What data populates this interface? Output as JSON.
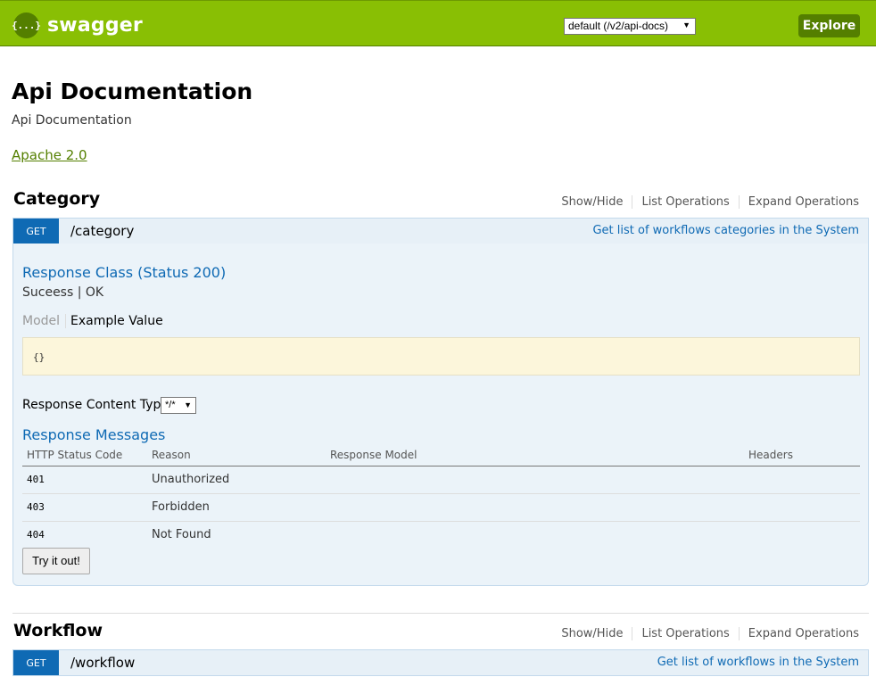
{
  "header": {
    "logo_symbol": "{...}",
    "logo_text": "swagger",
    "spec_select_value": "default (/v2/api-docs)",
    "explore_label": "Explore",
    "bg_color": "#89bf04"
  },
  "info": {
    "title": "Api Documentation",
    "description": "Api Documentation",
    "license": "Apache 2.0"
  },
  "resources": [
    {
      "name": "Category",
      "links": [
        "Show/Hide",
        "List Operations",
        "Expand Operations"
      ],
      "operation": {
        "method": "GET",
        "path": "/category",
        "summary": "Get list of workflows categories in the System",
        "response_class_heading": "Response Class (Status 200)",
        "response_class_text": "Suceess | OK",
        "model_tab": "Model",
        "example_tab": "Example Value",
        "example_value": "{}",
        "content_type_label": "Response Content Type",
        "content_type_value": "*/*",
        "response_messages_heading": "Response Messages",
        "table_headers": [
          "HTTP Status Code",
          "Reason",
          "Response Model",
          "Headers"
        ],
        "rows": [
          {
            "code": "401",
            "reason": "Unauthorized"
          },
          {
            "code": "403",
            "reason": "Forbidden"
          },
          {
            "code": "404",
            "reason": "Not Found"
          }
        ],
        "try_label": "Try it out!"
      }
    },
    {
      "name": "Workflow",
      "links": [
        "Show/Hide",
        "List Operations",
        "Expand Operations"
      ],
      "operation": {
        "method": "GET",
        "path": "/workflow",
        "summary": "Get list of workflows in the System"
      }
    }
  ]
}
